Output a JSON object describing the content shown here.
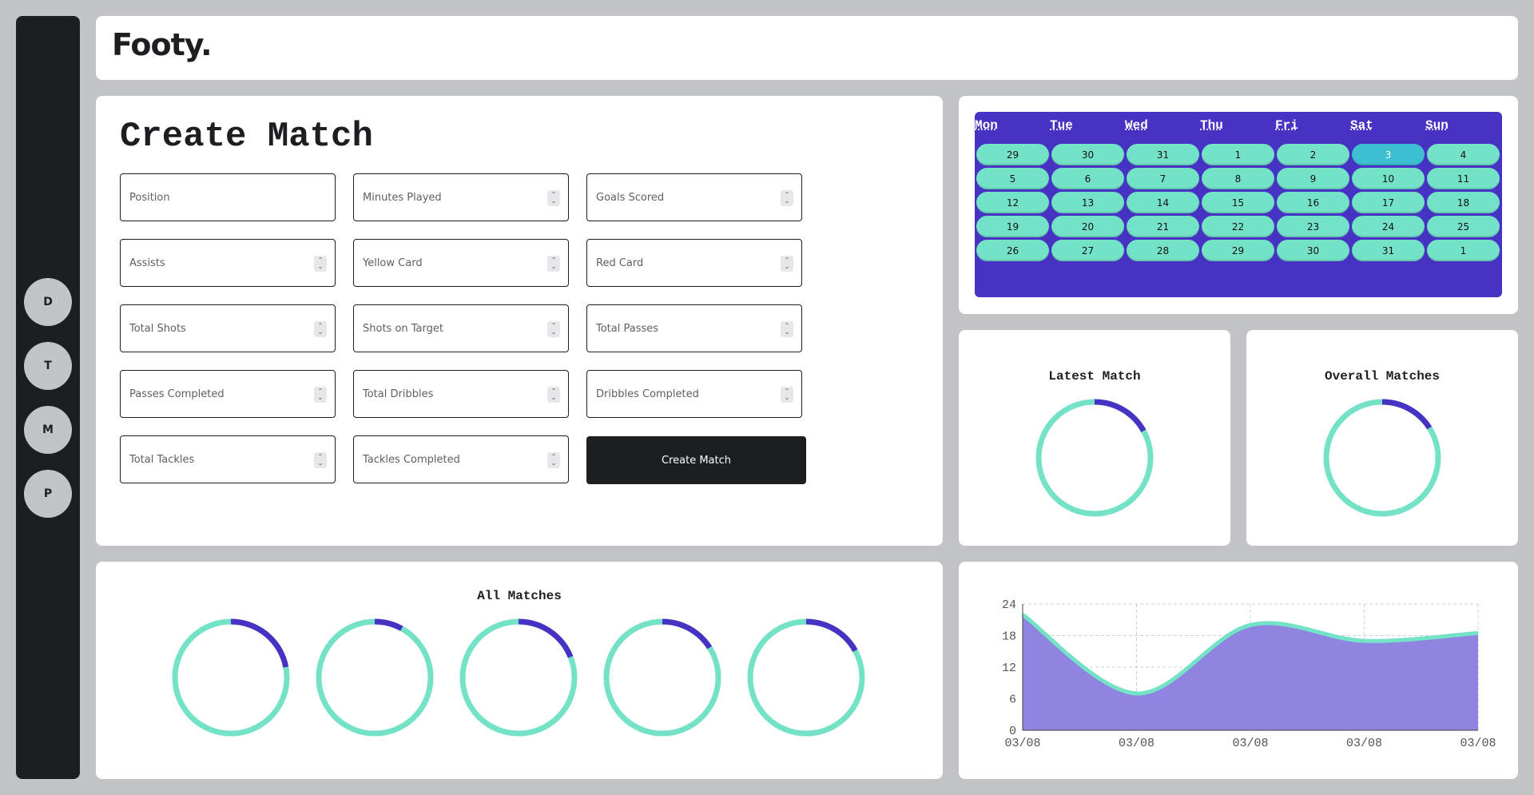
{
  "app": {
    "logo": "Footy."
  },
  "sidebar": {
    "items": [
      {
        "label": "D"
      },
      {
        "label": "T"
      },
      {
        "label": "M"
      },
      {
        "label": "P"
      }
    ]
  },
  "create_match": {
    "title": "Create Match",
    "fields": [
      {
        "placeholder": "Position",
        "value": "",
        "spinner": false
      },
      {
        "placeholder": "Minutes Played",
        "value": "",
        "spinner": true
      },
      {
        "placeholder": "Goals Scored",
        "value": "",
        "spinner": true
      },
      {
        "placeholder": "Assists",
        "value": "",
        "spinner": true
      },
      {
        "placeholder": "Yellow Card",
        "value": "",
        "spinner": true
      },
      {
        "placeholder": "Red Card",
        "value": "",
        "spinner": true
      },
      {
        "placeholder": "Total Shots",
        "value": "",
        "spinner": true
      },
      {
        "placeholder": "Shots on Target",
        "value": "",
        "spinner": true
      },
      {
        "placeholder": "Total Passes",
        "value": "",
        "spinner": true
      },
      {
        "placeholder": "Passes Completed",
        "value": "",
        "spinner": true
      },
      {
        "placeholder": "Total Dribbles",
        "value": "",
        "spinner": true
      },
      {
        "placeholder": "Dribbles Completed",
        "value": "",
        "spinner": true
      },
      {
        "placeholder": "Total Tackles",
        "value": "",
        "spinner": true
      },
      {
        "placeholder": "Tackles Completed",
        "value": "",
        "spinner": true
      }
    ],
    "submit_label": "Create Match"
  },
  "calendar": {
    "weekdays": [
      "Mon",
      "Tue",
      "Wed",
      "Thu",
      "Fri",
      "Sat",
      "Sun"
    ],
    "weeks": [
      [
        "29",
        "30",
        "31",
        "1",
        "2",
        "3",
        "4"
      ],
      [
        "5",
        "6",
        "7",
        "8",
        "9",
        "10",
        "11"
      ],
      [
        "12",
        "13",
        "14",
        "15",
        "16",
        "17",
        "18"
      ],
      [
        "19",
        "20",
        "21",
        "22",
        "23",
        "24",
        "25"
      ],
      [
        "26",
        "27",
        "28",
        "29",
        "30",
        "31",
        "1"
      ]
    ],
    "today": "3"
  },
  "latest_match": {
    "title": "Latest Match",
    "progress": 0.17
  },
  "overall_matches": {
    "title": "Overall Matches",
    "progress": 0.16
  },
  "all_matches": {
    "title": "All Matches",
    "progress": [
      0.22,
      0.08,
      0.19,
      0.16,
      0.17
    ]
  },
  "colors": {
    "ring_track": "#74e2c6",
    "ring_fill": "#4633c4",
    "area_fill": "#8f84e0",
    "area_line": "#74e2c6",
    "sidebar": "#1c1e22",
    "calendar": "#4633c4",
    "today": "#3cbfd0"
  },
  "chart_data": {
    "type": "area",
    "x": [
      "03/08",
      "03/08",
      "03/08",
      "03/08",
      "03/08"
    ],
    "values": [
      22,
      7,
      20,
      17,
      18.5
    ],
    "yticks": [
      "0",
      "6",
      "12",
      "18",
      "24"
    ],
    "ylim": [
      0,
      24
    ],
    "grid": true,
    "title": "",
    "xlabel": "",
    "ylabel": ""
  }
}
